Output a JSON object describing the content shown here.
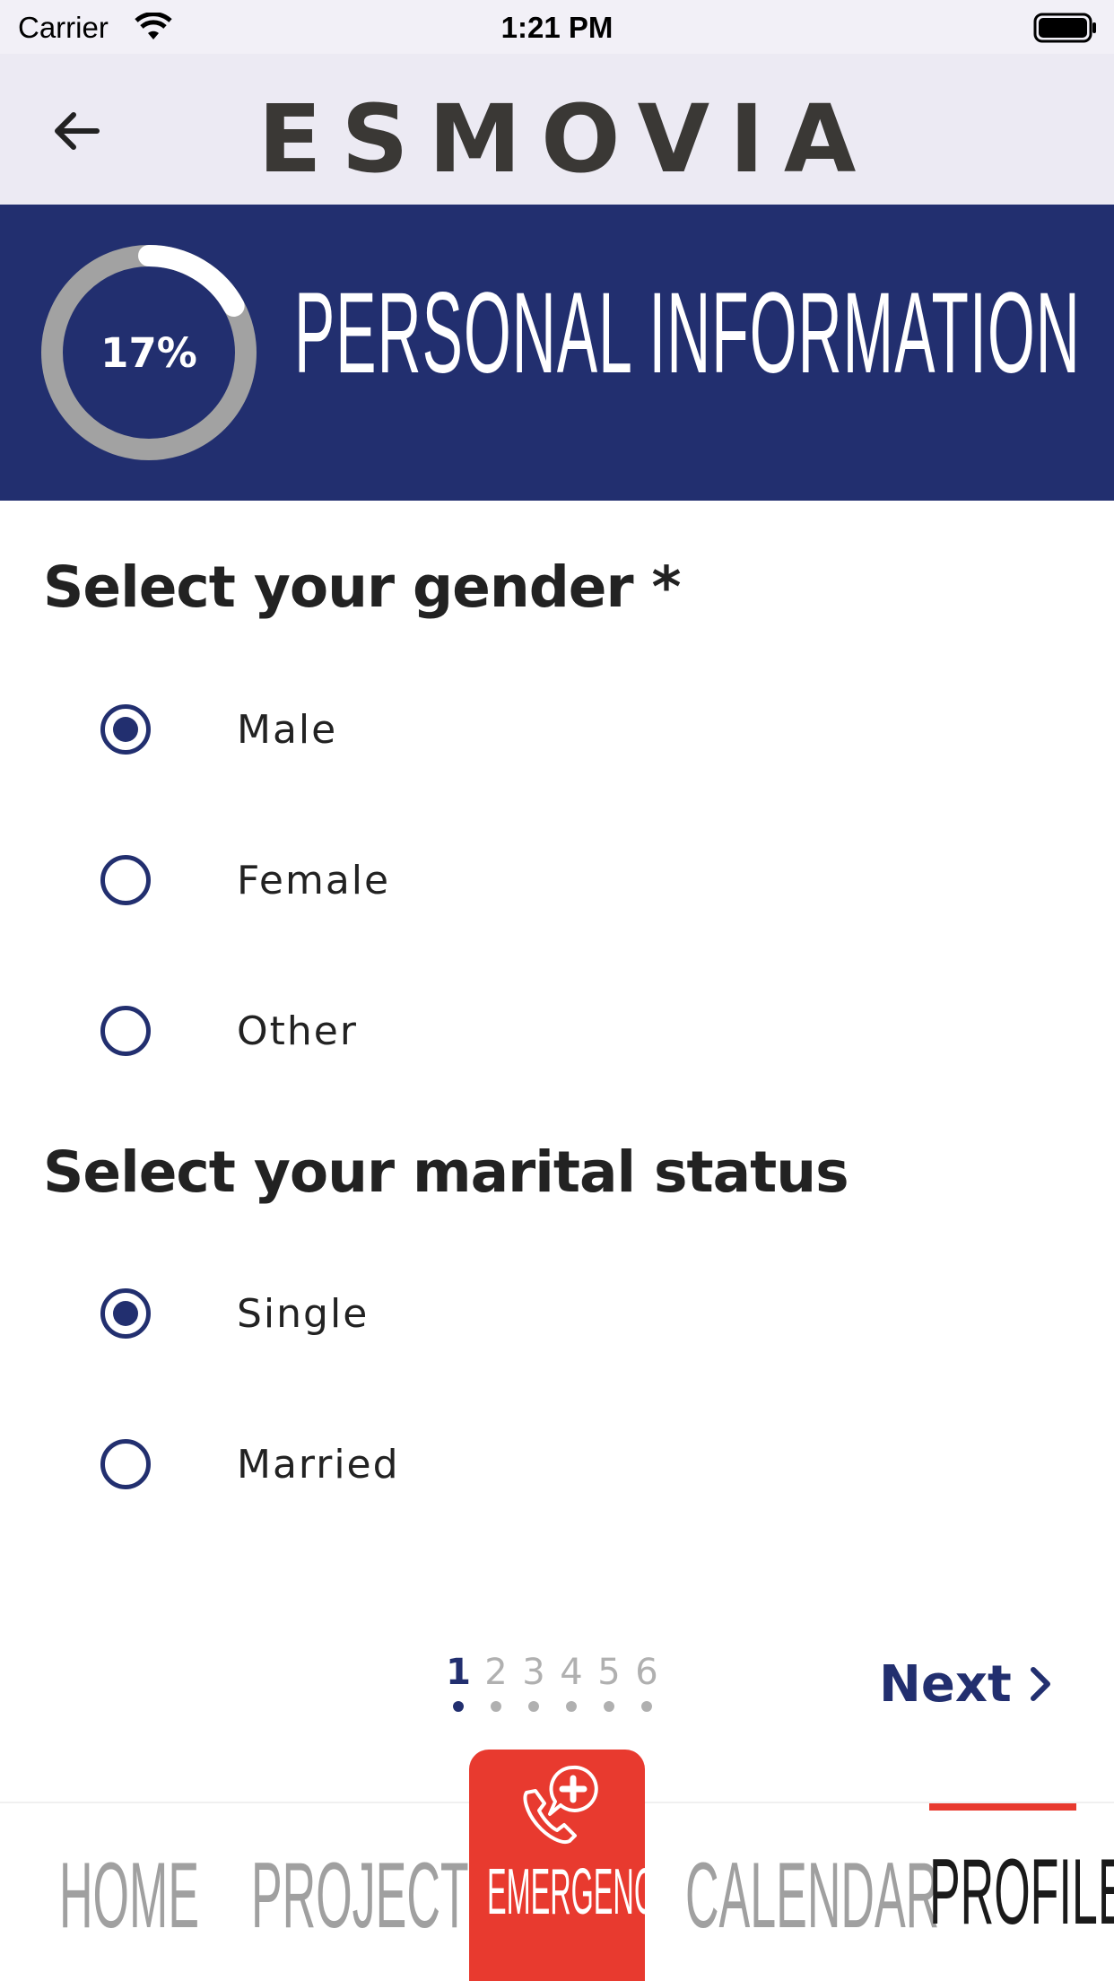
{
  "status_bar": {
    "carrier": "Carrier",
    "time": "1:21 PM"
  },
  "header": {
    "brand": "ESMOVIA",
    "back_icon": "arrow-left-icon"
  },
  "banner": {
    "progress_label": "17%",
    "progress_value": 0.17,
    "title": "PERSONAL INFORMATION"
  },
  "gender": {
    "title": "Select your gender *",
    "options": [
      {
        "label": "Male",
        "selected": true
      },
      {
        "label": "Female",
        "selected": false
      },
      {
        "label": "Other",
        "selected": false
      }
    ]
  },
  "marital": {
    "title": "Select your marital status",
    "options": [
      {
        "label": "Single",
        "selected": true
      },
      {
        "label": "Married",
        "selected": false
      }
    ]
  },
  "pager": {
    "pages": [
      "1",
      "2",
      "3",
      "4",
      "5",
      "6"
    ],
    "current": 1,
    "next_label": "Next"
  },
  "tabs": {
    "home": "HOME",
    "project": "PROJECT",
    "emergency": "EMERGENCY",
    "calendar": "CALENDAR",
    "profile": "PROFILE",
    "active": "profile"
  },
  "colors": {
    "primary": "#222f6f",
    "accent": "#e83a2f",
    "inactive": "#a0a0a0"
  }
}
